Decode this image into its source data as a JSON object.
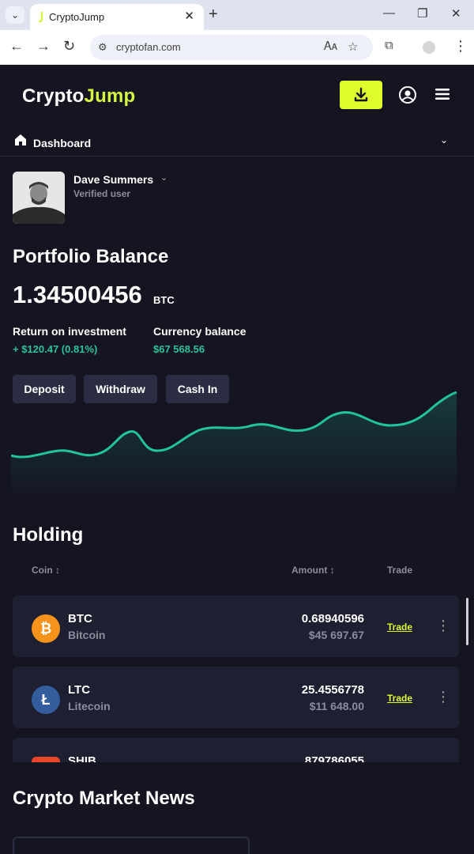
{
  "browser": {
    "tab_title": "CryptoJump",
    "url": "cryptofan.com"
  },
  "app": {
    "logo_part1": "Crypto",
    "logo_part2": "Jump",
    "accent_color": "#dffd2c",
    "positive_color": "#28c39a",
    "nav": {
      "dashboard_label": "Dashboard"
    }
  },
  "user": {
    "name": "Dave Summers",
    "status": "Verified user"
  },
  "portfolio": {
    "title": "Portfolio Balance",
    "balance": "1.34500456",
    "unit": "BTC",
    "roi_label": "Return on investment",
    "roi_value": "+ $120.47 (0.81%)",
    "currency_label": "Currency balance",
    "currency_value": "$67 568.56",
    "buttons": {
      "deposit": "Deposit",
      "withdraw": "Withdraw",
      "cash_in": "Cash In"
    }
  },
  "holding": {
    "title": "Holding",
    "columns": {
      "coin": "Coin",
      "amount": "Amount",
      "trade": "Trade"
    },
    "rows": [
      {
        "symbol": "BTC",
        "name": "Bitcoin",
        "amount": "0.68940596",
        "fiat": "$45 697.67",
        "trade": "Trade",
        "icon": "bitcoin-icon",
        "color": "#f7931a"
      },
      {
        "symbol": "LTC",
        "name": "Litecoin",
        "amount": "25.4556778",
        "fiat": "$11 648.00",
        "trade": "Trade",
        "icon": "litecoin-icon",
        "color": "#345d9d"
      },
      {
        "symbol": "SHIB",
        "name": "",
        "amount": "879786055",
        "fiat": "",
        "trade": "",
        "icon": "shiba-icon",
        "color": "#e8472a"
      }
    ]
  },
  "news": {
    "title": "Crypto Market News"
  }
}
